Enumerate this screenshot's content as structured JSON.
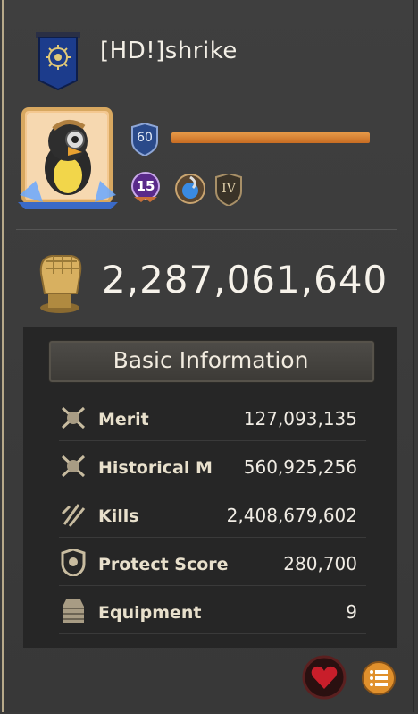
{
  "player": {
    "name": "[HD!]shrike",
    "level": "60",
    "level_progress": 1.0,
    "rank": "15",
    "tier": "IV",
    "power": "2,287,061,640"
  },
  "basic_info": {
    "title": "Basic Information",
    "rows": [
      {
        "label": "Merit",
        "value": "127,093,135",
        "icon": "crossed-swords-skull-icon"
      },
      {
        "label": "Historical M",
        "value": "560,925,256",
        "icon": "crossed-swords-skull-icon"
      },
      {
        "label": "Kills",
        "value": "2,408,679,602",
        "icon": "slash-icon"
      },
      {
        "label": "Protect Score",
        "value": "280,700",
        "icon": "shield-icon"
      },
      {
        "label": "Equipment",
        "value": "9",
        "icon": "armor-icon"
      }
    ]
  },
  "colors": {
    "xp_bar": "#d27a2e",
    "banner": "#1c3c8c",
    "heart": "#c81e2a",
    "list_button": "#e0902c"
  }
}
